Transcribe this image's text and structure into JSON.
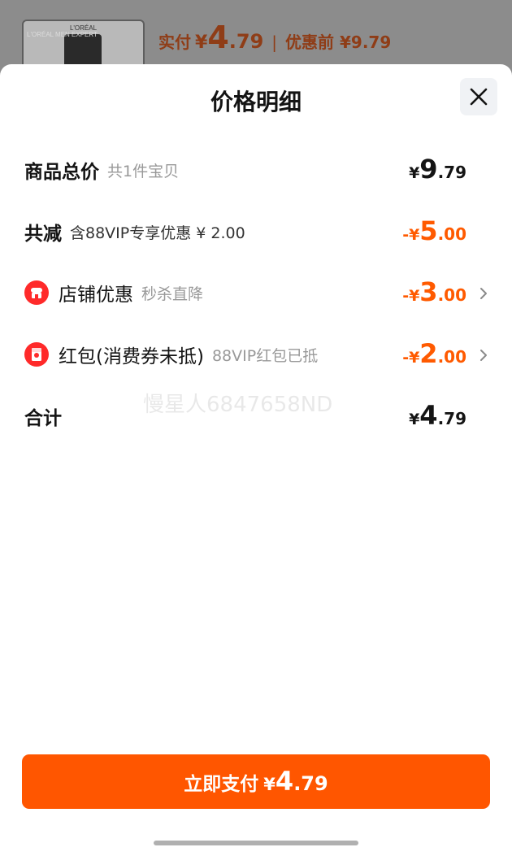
{
  "background": {
    "brand": "L'ORÉAL",
    "tube_text": "L'ORÉAL MEN EXPERT",
    "paid_label": "实付",
    "paid_currency": "¥",
    "paid_int": "4",
    "paid_dec": ".79",
    "separator": "|",
    "original": "优惠前 ¥9.79"
  },
  "sheet": {
    "title": "价格明细",
    "close_icon": "close-icon"
  },
  "rows": {
    "total": {
      "label": "商品总价",
      "sub": "共1件宝贝",
      "currency": "¥",
      "int": "9",
      "dec": ".79"
    },
    "reduced": {
      "label": "共减",
      "sub": "含88VIP专享优惠 ¥ 2.00",
      "currency": "-¥",
      "int": "5",
      "dec": ".00"
    },
    "store": {
      "icon": "store-icon",
      "label": "店铺优惠",
      "sub": "秒杀直降",
      "currency": "-¥",
      "int": "3",
      "dec": ".00"
    },
    "redpacket": {
      "icon": "red-packet-icon",
      "label": "红包(消费券未抵)",
      "sub": "88VIP红包已抵",
      "currency": "-¥",
      "int": "2",
      "dec": ".00"
    },
    "sum": {
      "label": "合计",
      "currency": "¥",
      "int": "4",
      "dec": ".79"
    }
  },
  "watermark": "慢星人6847658ND",
  "pay_button": {
    "label": "立即支付",
    "currency": "¥",
    "int": "4",
    "dec": ".79"
  },
  "colors": {
    "accent": "#ff5600",
    "discount": "#ff5a00",
    "icon_red": "#ff2a2a"
  }
}
